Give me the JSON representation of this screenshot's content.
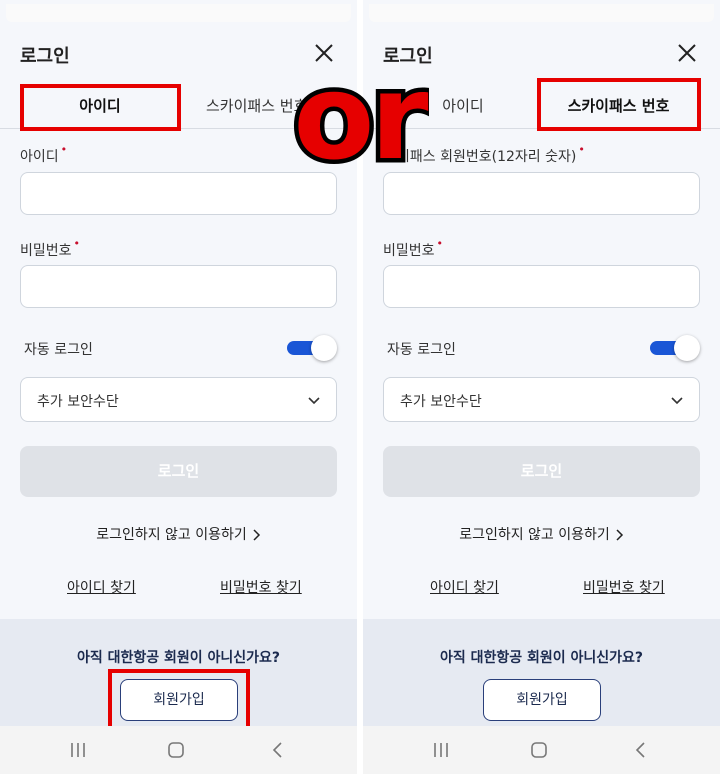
{
  "left": {
    "title": "로그인",
    "tabs": [
      "아이디",
      "스카이패스 번호"
    ],
    "active_tab": 0,
    "field1_label": "아이디",
    "field2_label": "비밀번호",
    "required_mark": "•",
    "auto_login_label": "자동 로그인",
    "auto_login_on": true,
    "security_select": "추가 보안수단",
    "login_button": "로그인",
    "guest_link": "로그인하지 않고 이용하기",
    "find_id": "아이디 찾기",
    "find_pw": "비밀번호 찾기",
    "not_member": "아직 대한항공 회원이 아니신가요?",
    "signup_button": "회원가입"
  },
  "right": {
    "title": "로그인",
    "tabs": [
      "아이디",
      "스카이패스 번호"
    ],
    "active_tab": 1,
    "field1_label": "이패스 회원번호(12자리 숫자)",
    "field2_label": "비밀번호",
    "required_mark": "•",
    "auto_login_label": "자동 로그인",
    "auto_login_on": true,
    "security_select": "추가 보안수단",
    "login_button": "로그인",
    "guest_link": "로그인하지 않고 이용하기",
    "find_id": "아이디 찾기",
    "find_pw": "비밀번호 찾기",
    "not_member": "아직 대한항공 회원이 아니신가요?",
    "signup_button": "회원가입"
  },
  "overlay_text": "or",
  "colors": {
    "highlight": "#e60000",
    "toggle": "#1a56d6",
    "navy": "#1b2a4e",
    "required": "#c8102e",
    "disabled_button": "#dfe2e7"
  }
}
